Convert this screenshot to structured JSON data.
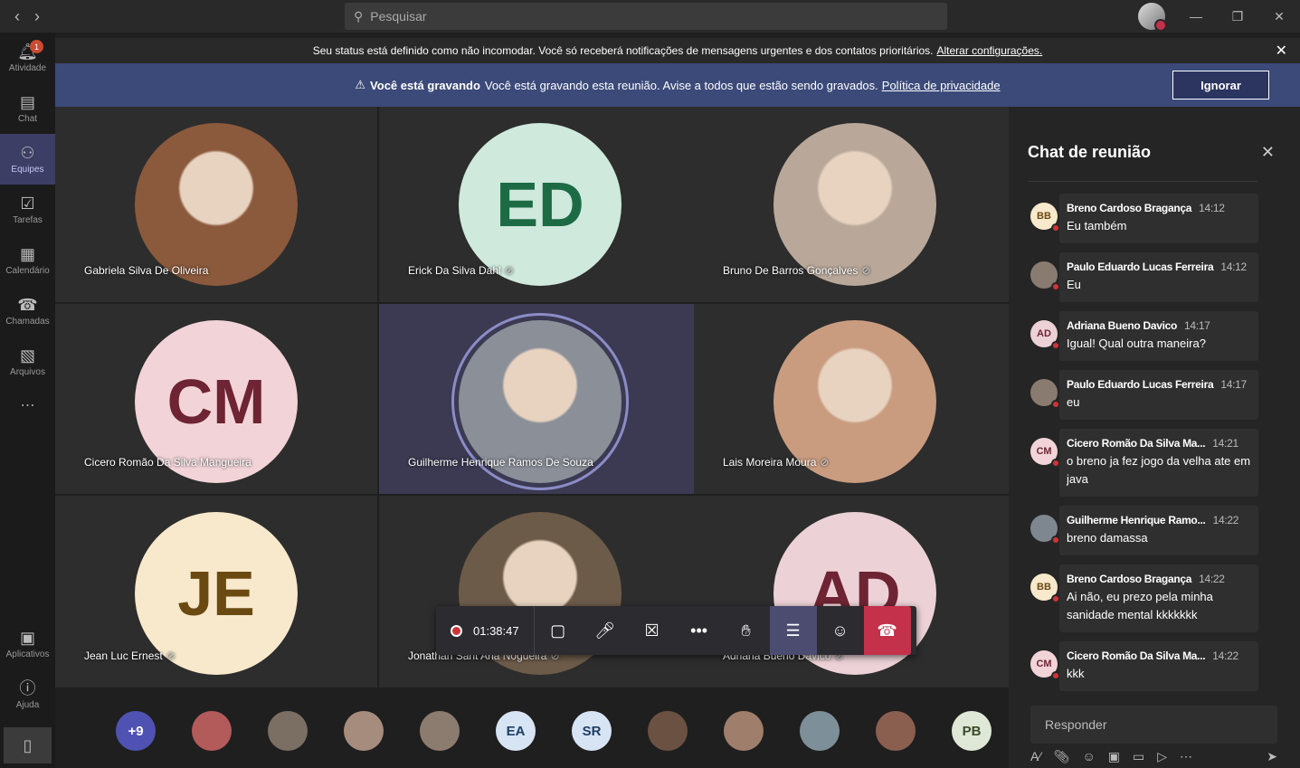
{
  "search": {
    "placeholder": "Pesquisar"
  },
  "rail": [
    {
      "label": "Atividade",
      "icon": "bell-icon",
      "badge": "1"
    },
    {
      "label": "Chat",
      "icon": "chat-icon"
    },
    {
      "label": "Equipes",
      "icon": "teams-icon",
      "active": true
    },
    {
      "label": "Tarefas",
      "icon": "tasks-icon"
    },
    {
      "label": "Calendário",
      "icon": "calendar-icon"
    },
    {
      "label": "Chamadas",
      "icon": "phone-icon"
    },
    {
      "label": "Arquivos",
      "icon": "files-icon"
    }
  ],
  "rail_bottom": [
    {
      "label": "Aplicativos"
    },
    {
      "label": "Ajuda"
    }
  ],
  "notice": {
    "text": "Seu status está definido como não incomodar. Você só receberá notificações de mensagens urgentes e dos contatos prioritários.",
    "link": "Alterar configurações."
  },
  "recording": {
    "bold": "Você está gravando",
    "text": "Você está gravando esta reunião. Avise a todos que estão sendo gravados.",
    "link": "Política de privacidade",
    "button": "Ignorar"
  },
  "participants": [
    {
      "name": "Gabriela Silva De Oliveira",
      "initials": "",
      "photo": true,
      "bg": "#8b5a3c",
      "fg": "#fff",
      "muted": false
    },
    {
      "name": "Erick Da Silva Dahl",
      "initials": "ED",
      "bg": "#cfe9dc",
      "fg": "#1d6b45",
      "muted": true
    },
    {
      "name": "Bruno De Barros Gonçalves",
      "initials": "",
      "photo": true,
      "bg": "#b9a89a",
      "fg": "#fff",
      "muted": true
    },
    {
      "name": "Cicero Romão Da Silva Mangueira",
      "initials": "CM",
      "bg": "#f2d4d8",
      "fg": "#6e2433",
      "muted": false
    },
    {
      "name": "Guilherme Henrique Ramos De Souza",
      "initials": "",
      "photo": true,
      "bg": "#8a8f98",
      "fg": "#fff",
      "muted": false
    },
    {
      "name": "Lais Moreira Moura",
      "initials": "",
      "photo": true,
      "bg": "#c99c80",
      "fg": "#fff",
      "muted": true
    },
    {
      "name": "Jean Luc Ernest",
      "initials": "JE",
      "bg": "#f8e9cc",
      "fg": "#6b4a12",
      "muted": true
    },
    {
      "name": "Jonathan Sant Ana Nogueira",
      "initials": "",
      "photo": true,
      "bg": "#6d5b4a",
      "fg": "#fff",
      "muted": true
    },
    {
      "name": "Adriana Bueno Davico",
      "initials": "AD",
      "bg": "#ecd2d6",
      "fg": "#6e2433",
      "muted": true
    }
  ],
  "controls": {
    "timer": "01:38:47"
  },
  "strip": [
    {
      "label": "+9",
      "bg": "#4f52b2",
      "fg": "#fff"
    },
    {
      "label": "",
      "bg": "#b35a5a"
    },
    {
      "label": "",
      "bg": "#7b6e63"
    },
    {
      "label": "",
      "bg": "#a58c7d"
    },
    {
      "label": "",
      "bg": "#8c7c70"
    },
    {
      "label": "EA",
      "bg": "#d7e4f3",
      "fg": "#1e3e66"
    },
    {
      "label": "SR",
      "bg": "#d7e4f3",
      "fg": "#1e3e66"
    },
    {
      "label": "",
      "bg": "#6b5142"
    },
    {
      "label": "",
      "bg": "#a07e6c"
    },
    {
      "label": "",
      "bg": "#7d8f99"
    },
    {
      "label": "",
      "bg": "#8a5f50"
    },
    {
      "label": "PB",
      "bg": "#dfe8d6",
      "fg": "#3b4a2a"
    }
  ],
  "chat": {
    "title": "Chat de reunião",
    "messages": [
      {
        "initials": "BB",
        "avbg": "#f8e9cc",
        "avfg": "#6b4a12",
        "author": "Breno Cardoso Bragança",
        "time": "14:12",
        "text": "Eu também"
      },
      {
        "initials": "",
        "avbg": "#8a7b70",
        "avfg": "#fff",
        "author": "Paulo Eduardo Lucas Ferreira",
        "time": "14:12",
        "text": "Eu"
      },
      {
        "initials": "AD",
        "avbg": "#ecd2d6",
        "avfg": "#6e2433",
        "author": "Adriana Bueno Davico",
        "time": "14:17",
        "text": "Igual! Qual outra maneira?"
      },
      {
        "initials": "",
        "avbg": "#8a7b70",
        "avfg": "#fff",
        "author": "Paulo Eduardo Lucas Ferreira",
        "time": "14:17",
        "text": "eu"
      },
      {
        "initials": "CM",
        "avbg": "#f2d4d8",
        "avfg": "#6e2433",
        "author": "Cicero Romão Da Silva Ma...",
        "time": "14:21",
        "text": "o breno ja fez jogo da velha ate em java"
      },
      {
        "initials": "",
        "avbg": "#7e8790",
        "avfg": "#fff",
        "author": "Guilherme Henrique Ramo...",
        "time": "14:22",
        "text": "breno damassa"
      },
      {
        "initials": "BB",
        "avbg": "#f8e9cc",
        "avfg": "#6b4a12",
        "author": "Breno Cardoso Bragança",
        "time": "14:22",
        "text": "Ai não, eu prezo pela minha sanidade mental kkkkkkk"
      },
      {
        "initials": "CM",
        "avbg": "#f2d4d8",
        "avfg": "#6e2433",
        "author": "Cicero Romão Da Silva Ma...",
        "time": "14:22",
        "text": "kkk"
      }
    ],
    "reply_placeholder": "Responder"
  }
}
